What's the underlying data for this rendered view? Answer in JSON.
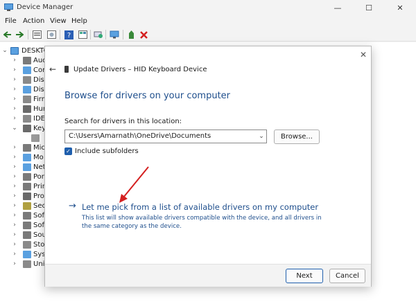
{
  "window": {
    "title": "Device Manager",
    "controls": {
      "minimize": "—",
      "maximize": "☐",
      "close": "✕"
    }
  },
  "menu": [
    "File",
    "Action",
    "View",
    "Help"
  ],
  "toolbar_icons": [
    "back-icon",
    "forward-icon",
    "properties-icon",
    "view-icon",
    "help-icon",
    "list-icon",
    "scan-icon",
    "monitor-icon",
    "add-driver-icon",
    "uninstall-icon"
  ],
  "tree": {
    "root": "DESKTC",
    "items": [
      {
        "label": "Auc",
        "icon": "audio-icon"
      },
      {
        "label": "Cor",
        "icon": "computer-icon"
      },
      {
        "label": "Disk",
        "icon": "disk-icon"
      },
      {
        "label": "Disp",
        "icon": "display-icon"
      },
      {
        "label": "Firm",
        "icon": "firmware-icon"
      },
      {
        "label": "Hur",
        "icon": "hid-icon"
      },
      {
        "label": "IDE",
        "icon": "ide-icon"
      },
      {
        "label": "Key",
        "icon": "keyboard-icon"
      },
      {
        "label": "",
        "icon": "keyboard-device-icon"
      },
      {
        "label": "Mic",
        "icon": "mice-icon"
      },
      {
        "label": "Mo",
        "icon": "monitor-icon"
      },
      {
        "label": "Net",
        "icon": "network-icon"
      },
      {
        "label": "Por",
        "icon": "ports-icon"
      },
      {
        "label": "Prin",
        "icon": "print-icon"
      },
      {
        "label": "Pro",
        "icon": "processor-icon"
      },
      {
        "label": "Sec",
        "icon": "security-icon"
      },
      {
        "label": "Soft",
        "icon": "software-icon"
      },
      {
        "label": "Soft",
        "icon": "software-icon"
      },
      {
        "label": "Sou",
        "icon": "sound-icon"
      },
      {
        "label": "Stor",
        "icon": "storage-icon"
      },
      {
        "label": "Syst",
        "icon": "system-icon"
      },
      {
        "label": "Univ",
        "icon": "usb-icon"
      }
    ]
  },
  "dialog": {
    "title": "Update Drivers – HID Keyboard Device",
    "heading": "Browse for drivers on your computer",
    "search_label": "Search for drivers in this location:",
    "path": "C:\\Users\\Amarnath\\OneDrive\\Documents",
    "browse_label": "Browse...",
    "include_subfolders": "Include subfolders",
    "pick_link": "Let me pick from a list of available drivers on my computer",
    "pick_description": "This list will show available drivers compatible with the device, and all drivers in the same category as the device.",
    "next_label": "Next",
    "cancel_label": "Cancel"
  },
  "colors": {
    "link": "#1e4e8c",
    "accent": "#1f5fad",
    "annotation_arrow": "#d42020"
  }
}
